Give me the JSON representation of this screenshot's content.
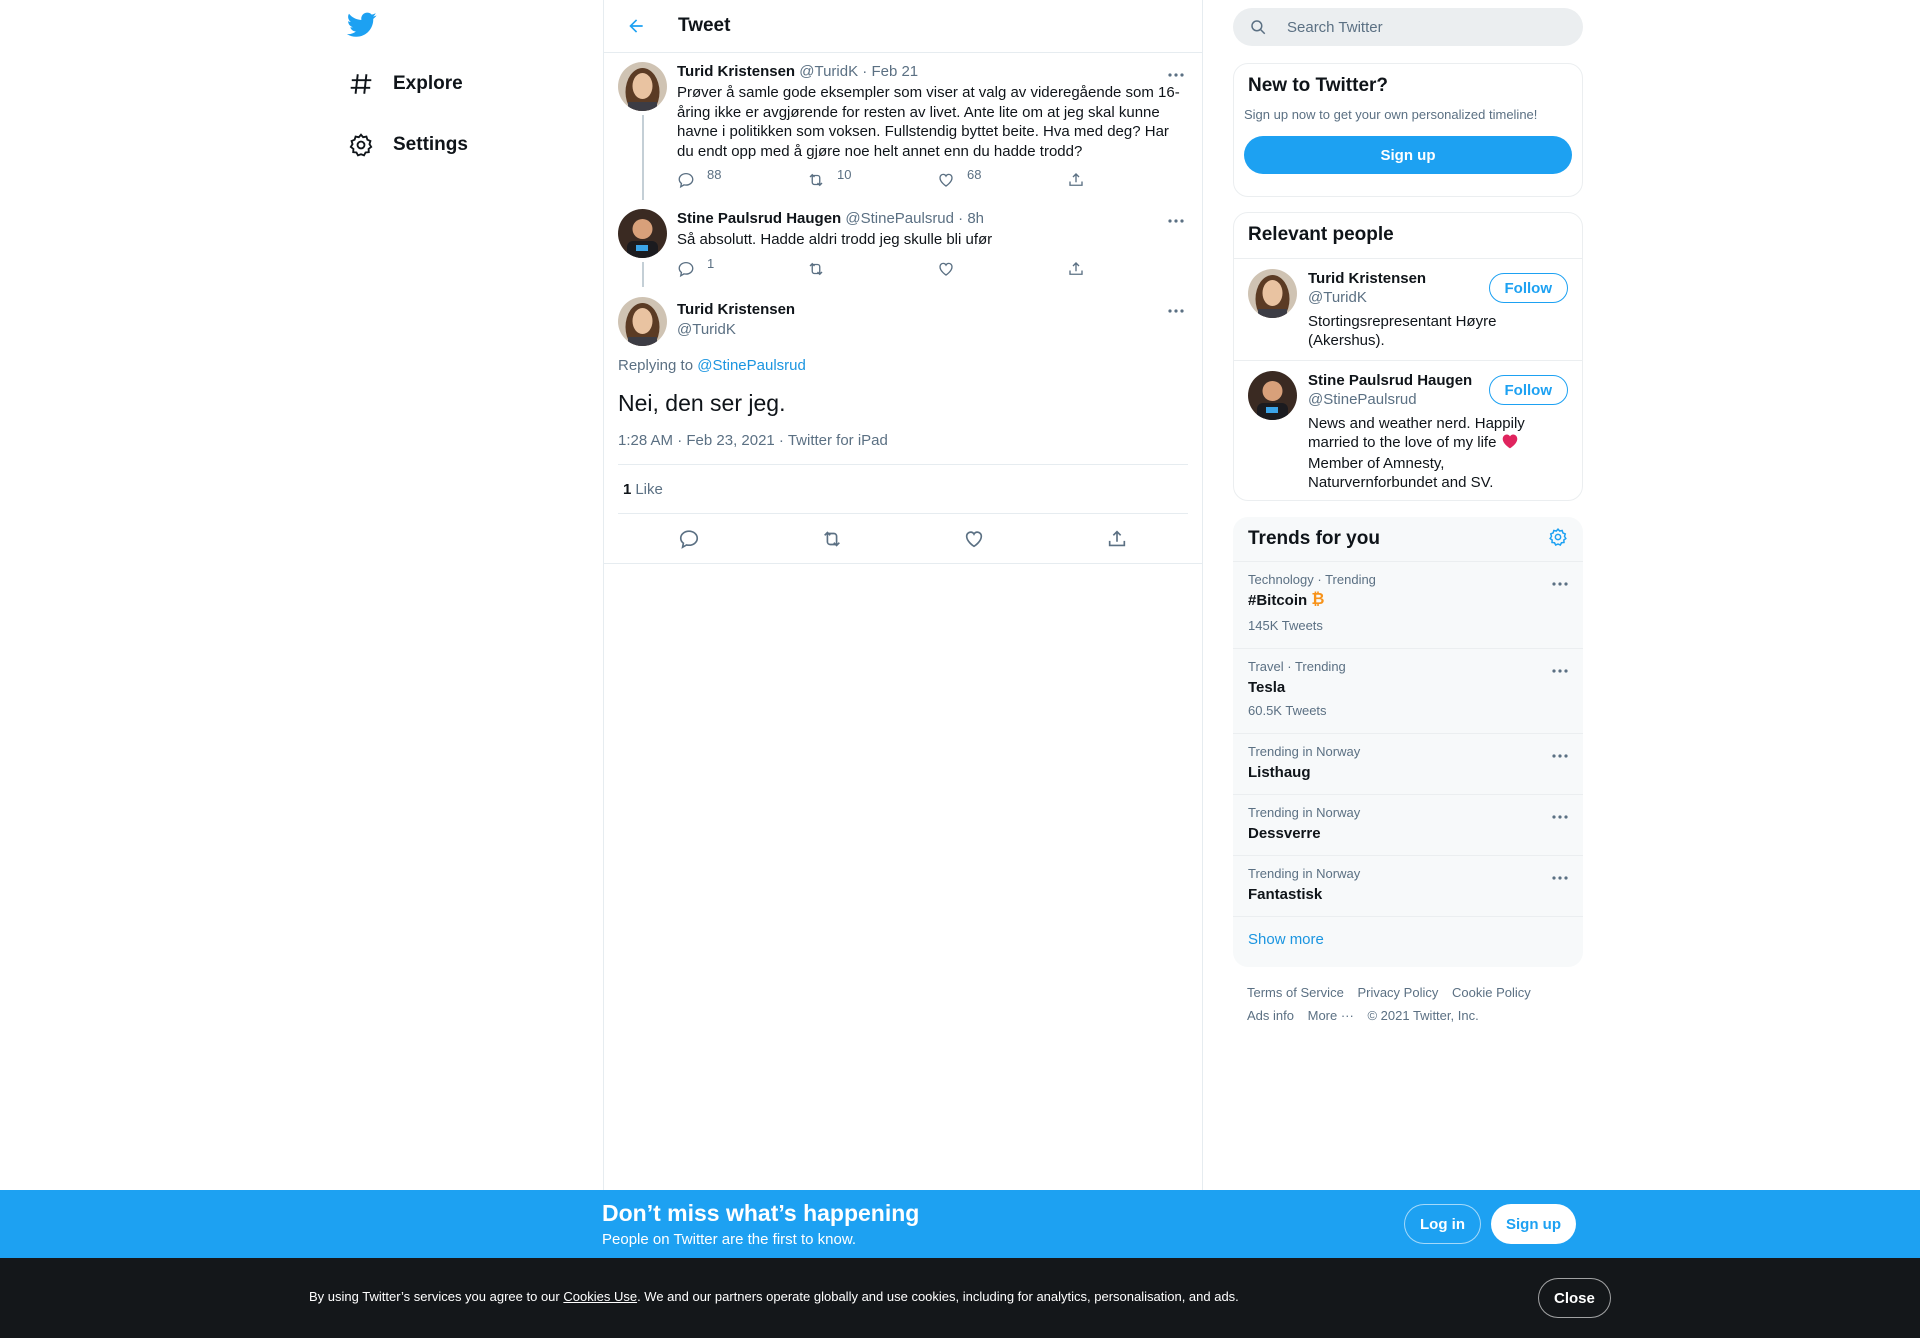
{
  "colors": {
    "accent": "#1da1f2",
    "link": "#1b95e0",
    "muted": "#5b7083",
    "heart": "#e0245e",
    "bitcoin": "#f7931a"
  },
  "nav": {
    "logo_icon": "twitter-bird-icon",
    "items": [
      {
        "label": "Explore",
        "icon": "hashtag-icon"
      },
      {
        "label": "Settings",
        "icon": "gear-icon"
      }
    ]
  },
  "header": {
    "title": "Tweet"
  },
  "thread": [
    {
      "name": "Turid Kristensen",
      "handle": "@TuridK",
      "time": "· Feb 21",
      "text": "Prøver å samle gode eksempler som viser at valg av videregående som 16-åring ikke er avgjørende for resten av livet. Ante lite om at jeg skal kunne havne i politikken som voksen. Fullstendig byttet beite. Hva med deg? Har du endt opp med å gjøre noe helt annet enn du hadde trodd?",
      "replies": "88",
      "retweets": "10",
      "likes": "68"
    },
    {
      "name": "Stine Paulsrud Haugen",
      "handle": "@StinePaulsrud",
      "time": "· 8h",
      "text": "Så absolutt. Hadde aldri trodd jeg skulle bli ufør",
      "replies": "1",
      "retweets": "",
      "likes": ""
    }
  ],
  "main_tweet": {
    "name": "Turid Kristensen",
    "handle": "@TuridK",
    "replying_prefix": "Replying to",
    "replying_to": "@StinePaulsrud",
    "text": "Nei, den ser jeg.",
    "timestamp": "1:28 AM · Feb 23, 2021 · Twitter for iPad",
    "like_count": "1",
    "like_label": "Like"
  },
  "search": {
    "placeholder": "Search Twitter"
  },
  "new_to_twitter": {
    "title": "New to Twitter?",
    "subtitle": "Sign up now to get your own personalized timeline!",
    "button": "Sign up"
  },
  "relevant_people": {
    "title": "Relevant people",
    "people": [
      {
        "name": "Turid Kristensen",
        "handle": "@TuridK",
        "bio": "Stortingsrepresentant Høyre (Akershus).",
        "follow": "Follow"
      },
      {
        "name": "Stine Paulsrud Haugen",
        "handle": "@StinePaulsrud",
        "bio_part1": "News and weather nerd. Happily married to the love of my life",
        "bio_part2": "Member of Amnesty, Naturvernforbundet and SV.",
        "follow": "Follow"
      }
    ]
  },
  "trends": {
    "title": "Trends for you",
    "items": [
      {
        "context": "Technology · Trending",
        "name": "#Bitcoin",
        "count": "145K Tweets"
      },
      {
        "context": "Travel · Trending",
        "name": "Tesla",
        "count": "60.5K Tweets"
      },
      {
        "context": "Trending in Norway",
        "name": "Listhaug",
        "count": ""
      },
      {
        "context": "Trending in Norway",
        "name": "Dessverre",
        "count": ""
      },
      {
        "context": "Trending in Norway",
        "name": "Fantastisk",
        "count": ""
      }
    ],
    "show_more": "Show more"
  },
  "footer": {
    "links": [
      "Terms of Service",
      "Privacy Policy",
      "Cookie Policy",
      "Ads info",
      "More ···"
    ],
    "copyright": "© 2021 Twitter, Inc."
  },
  "banner": {
    "title": "Don’t miss what’s happening",
    "subtitle": "People on Twitter are the first to know.",
    "login": "Log in",
    "signup": "Sign up"
  },
  "cookie": {
    "prefix": "By using Twitter’s services you agree to our ",
    "link": "Cookies Use",
    "suffix": ". We and our partners operate globally and use cookies, including for analytics, personalisation, and ads.",
    "close": "Close"
  }
}
